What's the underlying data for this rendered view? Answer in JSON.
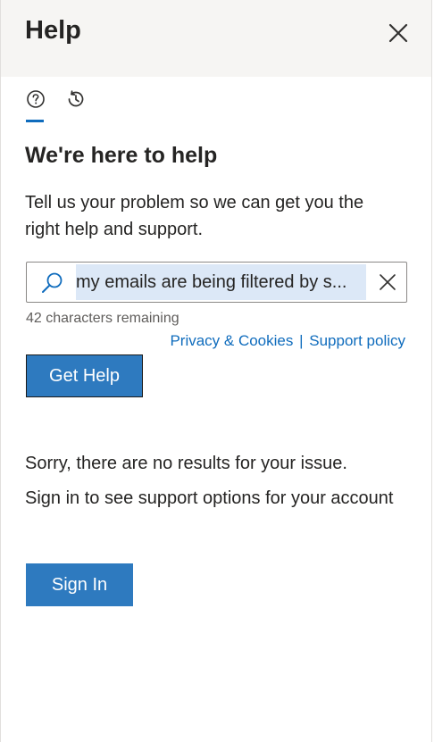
{
  "header": {
    "title": "Help",
    "close_icon": "close-icon"
  },
  "tabs": [
    {
      "name": "help",
      "icon": "question-circle-icon",
      "active": true
    },
    {
      "name": "history",
      "icon": "history-icon",
      "active": false
    }
  ],
  "main": {
    "heading": "We're here to help",
    "description": "Tell us your problem so we can get you the right help and support.",
    "search": {
      "value": "my emails are being filtered by s...",
      "icon": "search-icon",
      "clear_icon": "clear-icon"
    },
    "remaining": "42 characters remaining",
    "links": {
      "privacy": "Privacy & Cookies",
      "separator": "|",
      "support": "Support policy"
    },
    "get_help_label": "Get Help",
    "no_results": "Sorry, there are no results for your issue.",
    "sign_in_prompt": "Sign in to see support options for your account",
    "sign_in_label": "Sign In"
  },
  "colors": {
    "accent": "#0f6cbd",
    "button": "#2e7abf",
    "header_bg": "#f6f5f3"
  }
}
